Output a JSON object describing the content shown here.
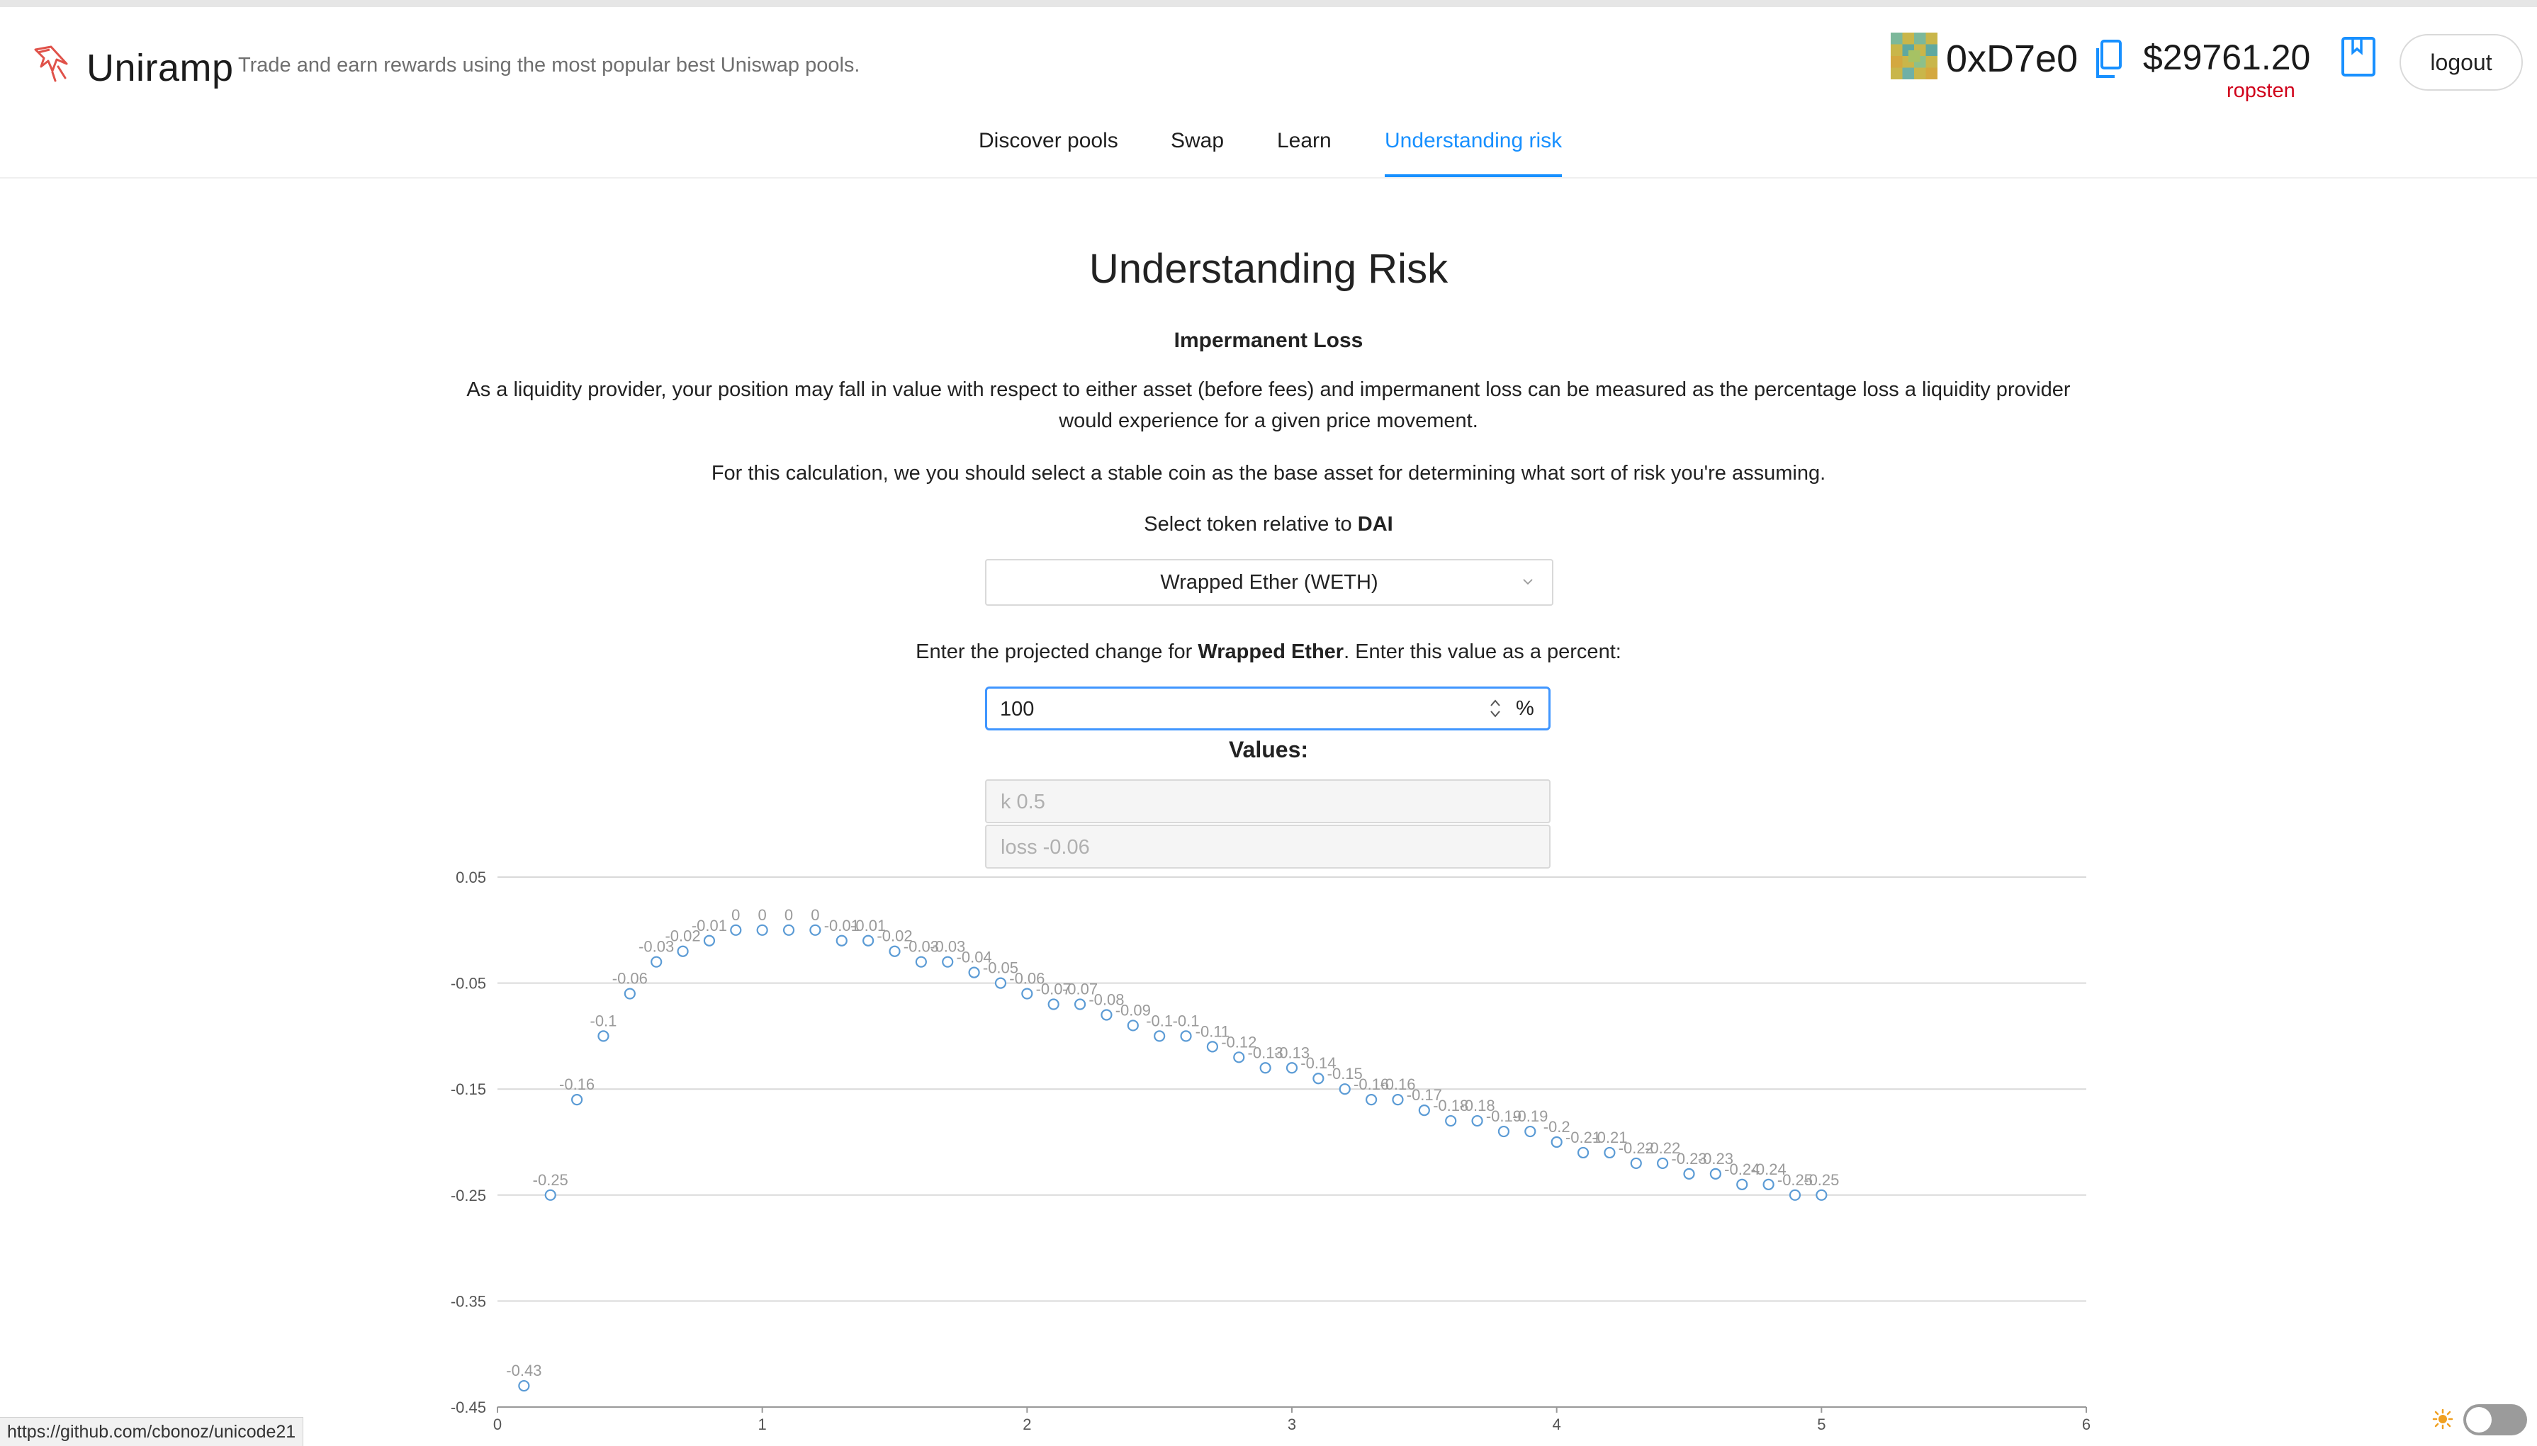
{
  "header": {
    "brand": "Uniramp",
    "tagline": "Trade and earn rewards using the most popular best Uniswap pools.",
    "address": "0xD7e0",
    "balance": "$29761.20",
    "network": "ropsten",
    "logout_label": "logout",
    "icons": [
      "uniramp-logo-icon",
      "avatar-icon",
      "copy-icon",
      "book-icon"
    ]
  },
  "nav": {
    "tabs": [
      {
        "label": "Discover pools",
        "active": false
      },
      {
        "label": "Swap",
        "active": false
      },
      {
        "label": "Learn",
        "active": false
      },
      {
        "label": "Understanding risk",
        "active": true
      }
    ]
  },
  "main": {
    "title": "Understanding Risk",
    "subtitle": "Impermanent Loss",
    "para1": "As a liquidity provider, your position may fall in value with respect to either asset (before fees) and impermanent loss can be measured as the percentage loss a liquidity provider would experience for a given price movement.",
    "para2": "For this calculation, we you should select a stable coin as the base asset for determining what sort of risk you're assuming.",
    "select_prompt_prefix": "Select token relative to ",
    "select_prompt_token": "DAI",
    "token_select_value": "Wrapped Ether (WETH)",
    "change_prompt_prefix": "Enter the projected change for ",
    "change_prompt_token": "Wrapped Ether",
    "change_prompt_suffix": ". Enter this value as a percent:",
    "percent_value": "100",
    "percent_suffix": "%",
    "values_label": "Values:",
    "k_field": "k 0.5",
    "loss_field": "loss -0.06"
  },
  "chart_data": {
    "type": "scatter",
    "xlim": [
      0,
      6
    ],
    "ylim": [
      -0.45,
      0.05
    ],
    "x_ticks": [
      0,
      1,
      2,
      3,
      4,
      5,
      6
    ],
    "y_ticks": [
      0.05,
      -0.05,
      -0.15,
      -0.25,
      -0.35,
      -0.45
    ],
    "grid": true,
    "marker_color": "#5b9bd5",
    "label_color": "#9a9a9a",
    "x": [
      0.1,
      0.2,
      0.3,
      0.4,
      0.5,
      0.6,
      0.7,
      0.8,
      0.9,
      1.0,
      1.1,
      1.2,
      1.3,
      1.4,
      1.5,
      1.6,
      1.7,
      1.8,
      1.9,
      2.0,
      2.1,
      2.2,
      2.3,
      2.4,
      2.5,
      2.6,
      2.7,
      2.8,
      2.9,
      3.0,
      3.1,
      3.2,
      3.3,
      3.4,
      3.5,
      3.6,
      3.7,
      3.8,
      3.9,
      4.0,
      4.1,
      4.2,
      4.3,
      4.4,
      4.5,
      4.6,
      4.7,
      4.8,
      4.9,
      5.0
    ],
    "y": [
      -0.43,
      -0.25,
      -0.16,
      -0.1,
      -0.06,
      -0.03,
      -0.02,
      -0.01,
      0,
      0,
      0,
      0,
      -0.01,
      -0.01,
      -0.02,
      -0.03,
      -0.03,
      -0.04,
      -0.05,
      -0.06,
      -0.07,
      -0.07,
      -0.08,
      -0.09,
      -0.1,
      -0.1,
      -0.11,
      -0.12,
      -0.13,
      -0.13,
      -0.14,
      -0.15,
      -0.16,
      -0.16,
      -0.17,
      -0.18,
      -0.18,
      -0.19,
      -0.19,
      -0.2,
      -0.21,
      -0.21,
      -0.22,
      -0.22,
      -0.23,
      -0.23,
      -0.24,
      -0.24,
      -0.25,
      -0.25
    ]
  },
  "status": {
    "url": "https://github.com/cbonoz/unicode21",
    "icons": [
      "sun-icon",
      "theme-toggle"
    ]
  }
}
